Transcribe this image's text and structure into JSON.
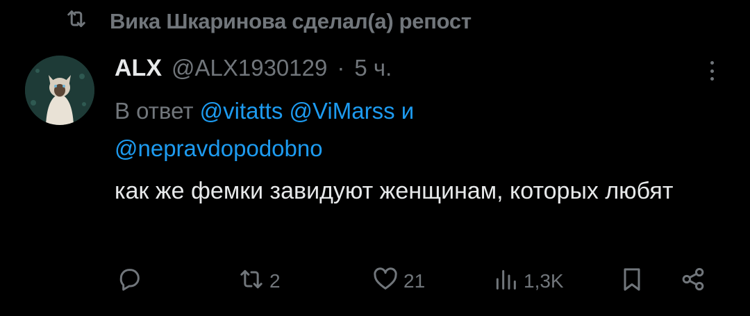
{
  "repost": {
    "icon": "repost-icon",
    "text": "Вика Шкаринова сделал(а) репост"
  },
  "tweet": {
    "name": "ALX",
    "handle": "@ALX1930129",
    "dot": "·",
    "time": "5 ч.",
    "reply_prefix": "В ответ",
    "mentions": [
      "@vitatts",
      "@ViMarss"
    ],
    "reply_and": "и",
    "mention_last": "@nepravdopodobno",
    "text": "как же фемки завидуют женщинам, которых любят"
  },
  "actions": {
    "reply": {
      "icon": "reply-icon",
      "count": ""
    },
    "retweet": {
      "icon": "retweet-icon",
      "count": "2"
    },
    "like": {
      "icon": "heart-icon",
      "count": "21"
    },
    "views": {
      "icon": "views-icon",
      "count": "1,3K"
    },
    "bookmark": {
      "icon": "bookmark-icon"
    },
    "share": {
      "icon": "share-icon"
    }
  },
  "colors": {
    "background": "#000000",
    "text": "#e7e9ea",
    "muted": "#71767b",
    "link": "#1d9bf0"
  }
}
